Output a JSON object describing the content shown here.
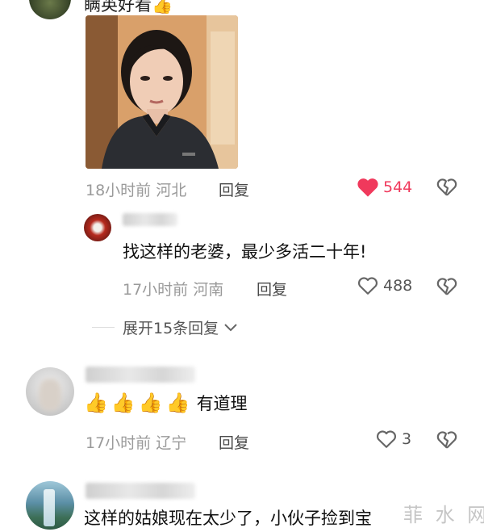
{
  "comment1": {
    "partial_text": "瞒英好看",
    "time": "18小时前",
    "location": "河北",
    "reply_label": "回复",
    "likes": "544",
    "liked": true
  },
  "reply1": {
    "username": "春景开",
    "text": "找这样的老婆，最少多活二十年!",
    "time": "17小时前",
    "location": "河南",
    "reply_label": "回复",
    "likes": "488"
  },
  "expand": {
    "label": "展开15条回复"
  },
  "comment2": {
    "username": "喜来",
    "text": "有道理",
    "emoji_count": 4,
    "time": "17小时前",
    "location": "辽宁",
    "reply_label": "回复",
    "likes": "3"
  },
  "comment3": {
    "username": "微风细雨",
    "text": "这样的姑娘现在太少了，小伙子捡到宝"
  },
  "watermark": {
    "text": "菲 水 网"
  },
  "colors": {
    "liked_heart": "#f0395c",
    "meta_gray": "#9a9a9a"
  }
}
